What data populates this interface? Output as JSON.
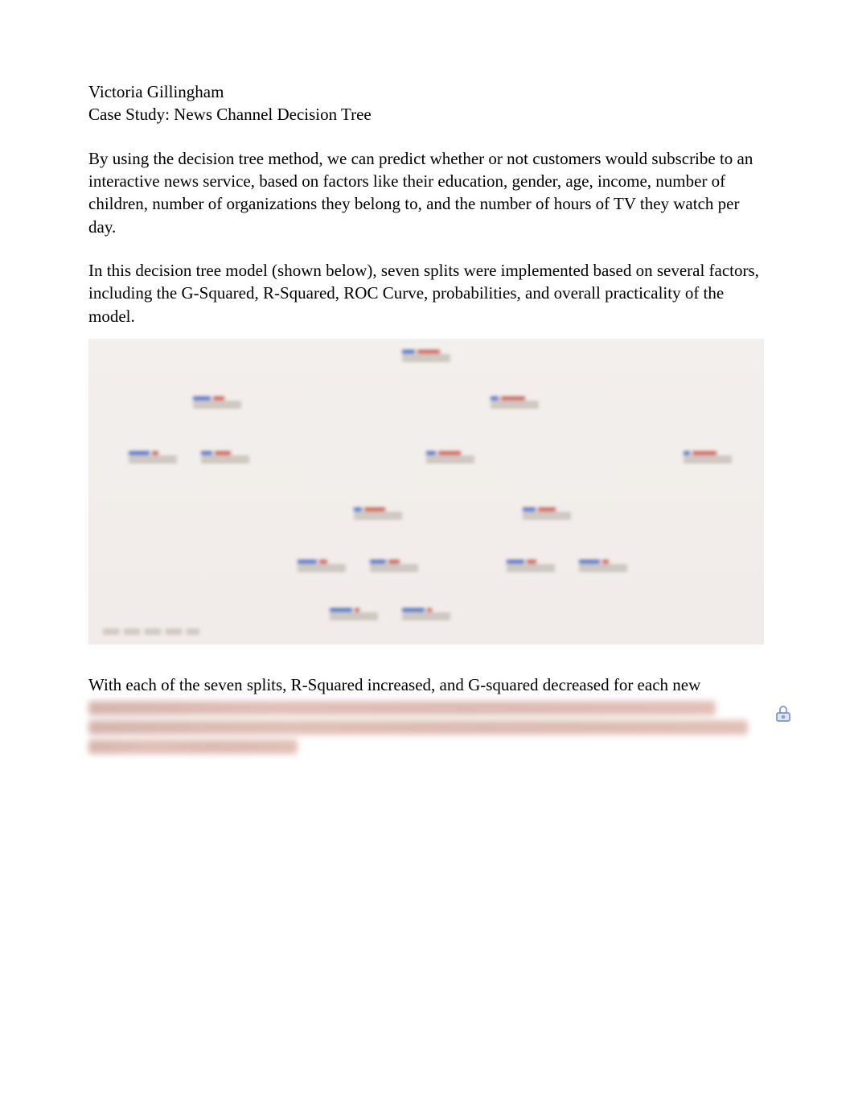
{
  "header": {
    "author": "Victoria Gillingham",
    "title": "Case Study: News Channel Decision Tree"
  },
  "paragraphs": {
    "p1": "By using the decision tree method, we can predict whether or not customers would subscribe to an interactive news service, based on factors like their education, gender, age, income, number of children, number of organizations they belong to, and the number of hours of TV they watch per day.",
    "p2": "In this decision tree model (shown below), seven splits were implemented based on several factors, including the G-Squared, R-Squared, ROC Curve, probabilities, and overall practicality of the model.",
    "p3": "With each of the seven splits, R-Squared increased, and G-squared decreased for each new"
  },
  "figure": {
    "name": "decision-tree-diagram",
    "alt": "Blurred screenshot of a multi-level decision tree with red and blue bar nodes"
  },
  "redacted": {
    "lines": 3
  },
  "icons": {
    "lock": "lock-icon"
  }
}
